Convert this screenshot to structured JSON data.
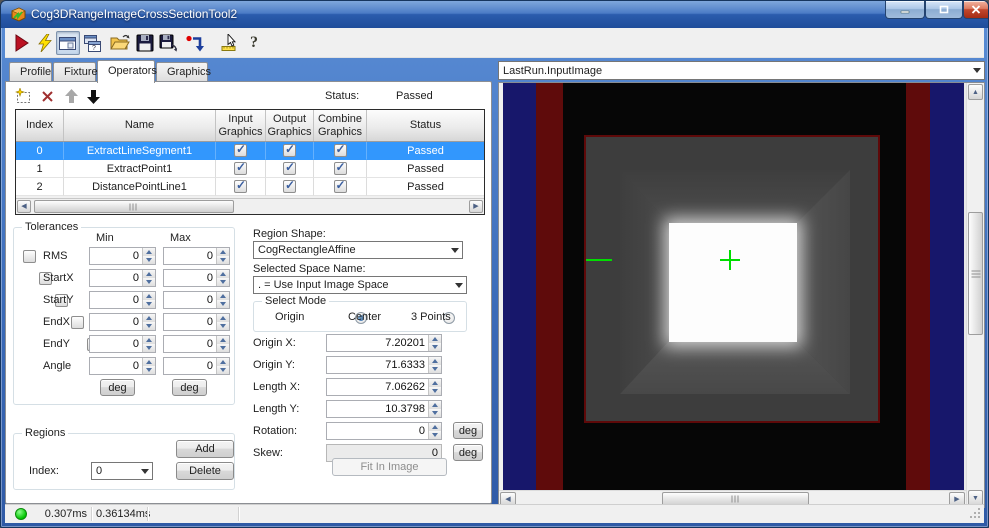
{
  "colors": {
    "sel": "#3297fd",
    "navy": "#17176b",
    "vred": "#5f0b0b",
    "green": "#00dd00",
    "dot": "#00c400"
  },
  "window": {
    "title": "Cog3DRangeImageCrossSectionTool2"
  },
  "toolbar": {
    "icons": [
      "run",
      "run-lightning",
      "show-result-display",
      "float-result-display",
      "open-file",
      "save-file",
      "save-file-as",
      "reset",
      "pointer-tool",
      "help"
    ]
  },
  "tabs": {
    "items": [
      {
        "label": "Profile"
      },
      {
        "label": "Fixture"
      },
      {
        "label": "Operators"
      },
      {
        "label": "Graphics"
      }
    ],
    "active": "Operators"
  },
  "operators": {
    "status_label": "Status:",
    "status_value": "Passed",
    "table": {
      "columns": [
        {
          "l1": "Index",
          "l2": ""
        },
        {
          "l1": "Name",
          "l2": ""
        },
        {
          "l1": "Input",
          "l2": "Graphics"
        },
        {
          "l1": "Output",
          "l2": "Graphics"
        },
        {
          "l1": "Combine",
          "l2": "Graphics"
        },
        {
          "l1": "Status",
          "l2": ""
        }
      ],
      "rows": [
        {
          "index": "0",
          "name": "ExtractLineSegment1",
          "input": true,
          "output": true,
          "combine": true,
          "status": "Passed",
          "selected": true
        },
        {
          "index": "1",
          "name": "ExtractPoint1",
          "input": true,
          "output": true,
          "combine": true,
          "status": "Passed",
          "selected": false
        },
        {
          "index": "2",
          "name": "DistancePointLine1",
          "input": true,
          "output": true,
          "combine": true,
          "status": "Passed",
          "selected": false
        }
      ]
    }
  },
  "tolerances": {
    "title": "Tolerances",
    "min_header": "Min",
    "max_header": "Max",
    "deg_label": "deg",
    "rows": [
      {
        "label": "RMS",
        "min": "0",
        "max": "0",
        "checked": false
      },
      {
        "label": "StartX",
        "min": "0",
        "max": "0",
        "checked": false
      },
      {
        "label": "StartY",
        "min": "0",
        "max": "0",
        "checked": false
      },
      {
        "label": "EndX",
        "min": "0",
        "max": "0",
        "checked": false
      },
      {
        "label": "EndY",
        "min": "0",
        "max": "0",
        "checked": false
      },
      {
        "label": "Angle",
        "min": "0",
        "max": "0",
        "checked": false
      }
    ]
  },
  "region": {
    "shape_label": "Region Shape:",
    "shape_value": "CogRectangleAffine",
    "space_label": "Selected Space Name:",
    "space_value": ". = Use Input Image Space",
    "select_mode": {
      "title": "Select Mode",
      "options": [
        {
          "label": "Origin",
          "selected": true
        },
        {
          "label": "Center",
          "selected": false
        },
        {
          "label": "3 Points",
          "selected": false
        }
      ]
    },
    "fields": [
      {
        "label": "Origin X:",
        "value": "7.20201"
      },
      {
        "label": "Origin Y:",
        "value": "71.6333"
      },
      {
        "label": "Length X:",
        "value": "7.06262"
      },
      {
        "label": "Length Y:",
        "value": "10.3798"
      },
      {
        "label": "Rotation:",
        "value": "0"
      },
      {
        "label": "Skew:",
        "value": "0"
      }
    ],
    "deg_label": "deg",
    "fit_button": "Fit In Image"
  },
  "regions_group": {
    "title": "Regions",
    "index_label": "Index:",
    "index_value": "0",
    "add_button": "Add",
    "delete_button": "Delete"
  },
  "display": {
    "selector": "LastRun.InputImage"
  },
  "statusbar": {
    "time1": "0.307ms",
    "time2": "0.36134ms"
  }
}
